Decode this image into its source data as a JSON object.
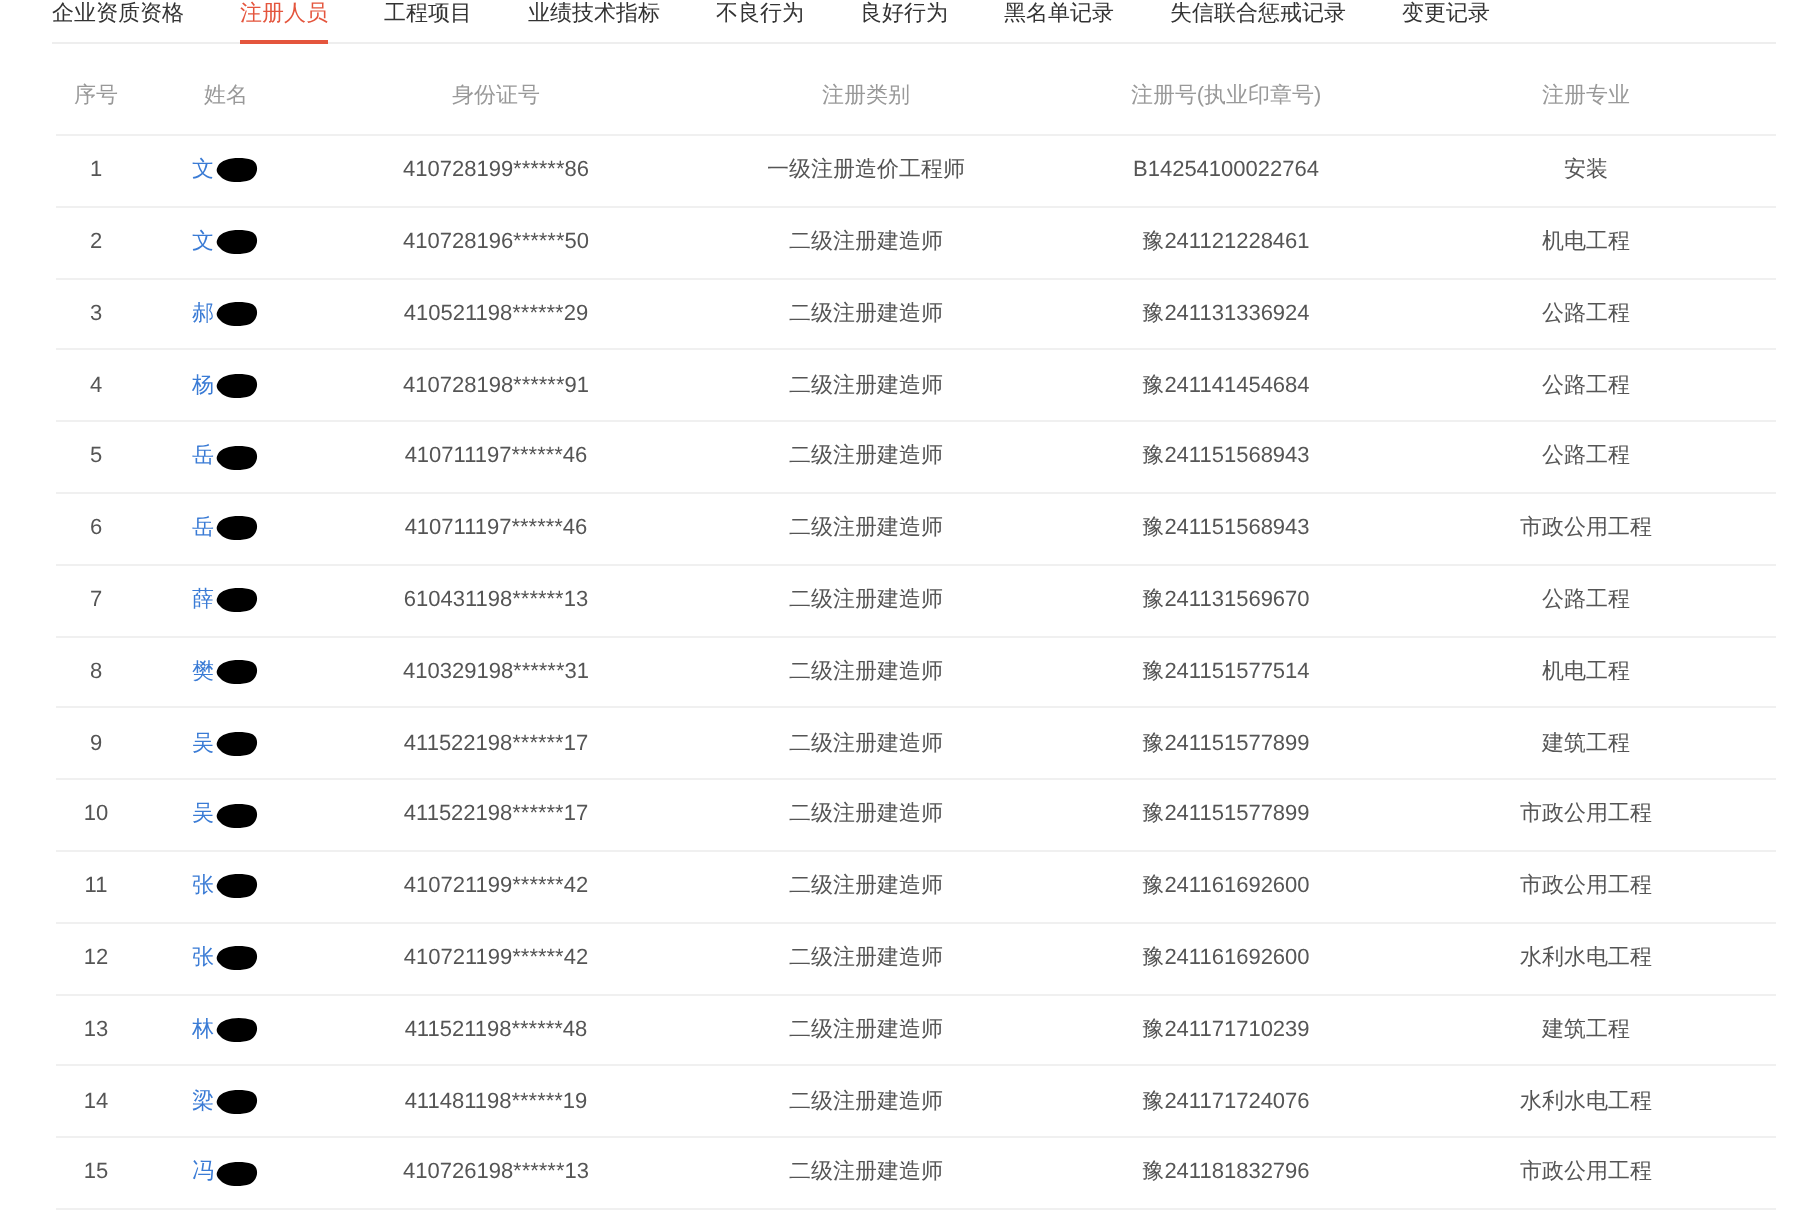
{
  "tabs": [
    {
      "label": "企业资质资格",
      "selected": false
    },
    {
      "label": "注册人员",
      "selected": true
    },
    {
      "label": "工程项目",
      "selected": false
    },
    {
      "label": "业绩技术指标",
      "selected": false
    },
    {
      "label": "不良行为",
      "selected": false
    },
    {
      "label": "良好行为",
      "selected": false
    },
    {
      "label": "黑名单记录",
      "selected": false
    },
    {
      "label": "失信联合惩戒记录",
      "selected": false
    },
    {
      "label": "变更记录",
      "selected": false
    }
  ],
  "table": {
    "columns": [
      "序号",
      "姓名",
      "身份证号",
      "注册类别",
      "注册号(执业印章号)",
      "注册专业"
    ],
    "rows": [
      {
        "index": "1",
        "name": "文",
        "id_number": "410728199******86",
        "category": "一级注册造价工程师",
        "reg_number": "B14254100022764",
        "specialty": "安装"
      },
      {
        "index": "2",
        "name": "文",
        "id_number": "410728196******50",
        "category": "二级注册建造师",
        "reg_number": "豫241121228461",
        "specialty": "机电工程"
      },
      {
        "index": "3",
        "name": "郝",
        "id_number": "410521198******29",
        "category": "二级注册建造师",
        "reg_number": "豫241131336924",
        "specialty": "公路工程"
      },
      {
        "index": "4",
        "name": "杨",
        "id_number": "410728198******91",
        "category": "二级注册建造师",
        "reg_number": "豫241141454684",
        "specialty": "公路工程"
      },
      {
        "index": "5",
        "name": "岳",
        "id_number": "410711197******46",
        "category": "二级注册建造师",
        "reg_number": "豫241151568943",
        "specialty": "公路工程"
      },
      {
        "index": "6",
        "name": "岳",
        "id_number": "410711197******46",
        "category": "二级注册建造师",
        "reg_number": "豫241151568943",
        "specialty": "市政公用工程"
      },
      {
        "index": "7",
        "name": "薛",
        "id_number": "610431198******13",
        "category": "二级注册建造师",
        "reg_number": "豫241131569670",
        "specialty": "公路工程"
      },
      {
        "index": "8",
        "name": "樊",
        "id_number": "410329198******31",
        "category": "二级注册建造师",
        "reg_number": "豫241151577514",
        "specialty": "机电工程"
      },
      {
        "index": "9",
        "name": "吴",
        "id_number": "411522198******17",
        "category": "二级注册建造师",
        "reg_number": "豫241151577899",
        "specialty": "建筑工程"
      },
      {
        "index": "10",
        "name": "吴",
        "id_number": "411522198******17",
        "category": "二级注册建造师",
        "reg_number": "豫241151577899",
        "specialty": "市政公用工程"
      },
      {
        "index": "11",
        "name": "张",
        "id_number": "410721199******42",
        "category": "二级注册建造师",
        "reg_number": "豫241161692600",
        "specialty": "市政公用工程"
      },
      {
        "index": "12",
        "name": "张",
        "id_number": "410721199******42",
        "category": "二级注册建造师",
        "reg_number": "豫241161692600",
        "specialty": "水利水电工程"
      },
      {
        "index": "13",
        "name": "林",
        "id_number": "411521198******48",
        "category": "二级注册建造师",
        "reg_number": "豫241171710239",
        "specialty": "建筑工程"
      },
      {
        "index": "14",
        "name": "梁",
        "id_number": "411481198******19",
        "category": "二级注册建造师",
        "reg_number": "豫241171724076",
        "specialty": "水利水电工程"
      },
      {
        "index": "15",
        "name": "冯",
        "id_number": "410726198******13",
        "category": "二级注册建造师",
        "reg_number": "豫241181832796",
        "specialty": "市政公用工程"
      }
    ]
  }
}
